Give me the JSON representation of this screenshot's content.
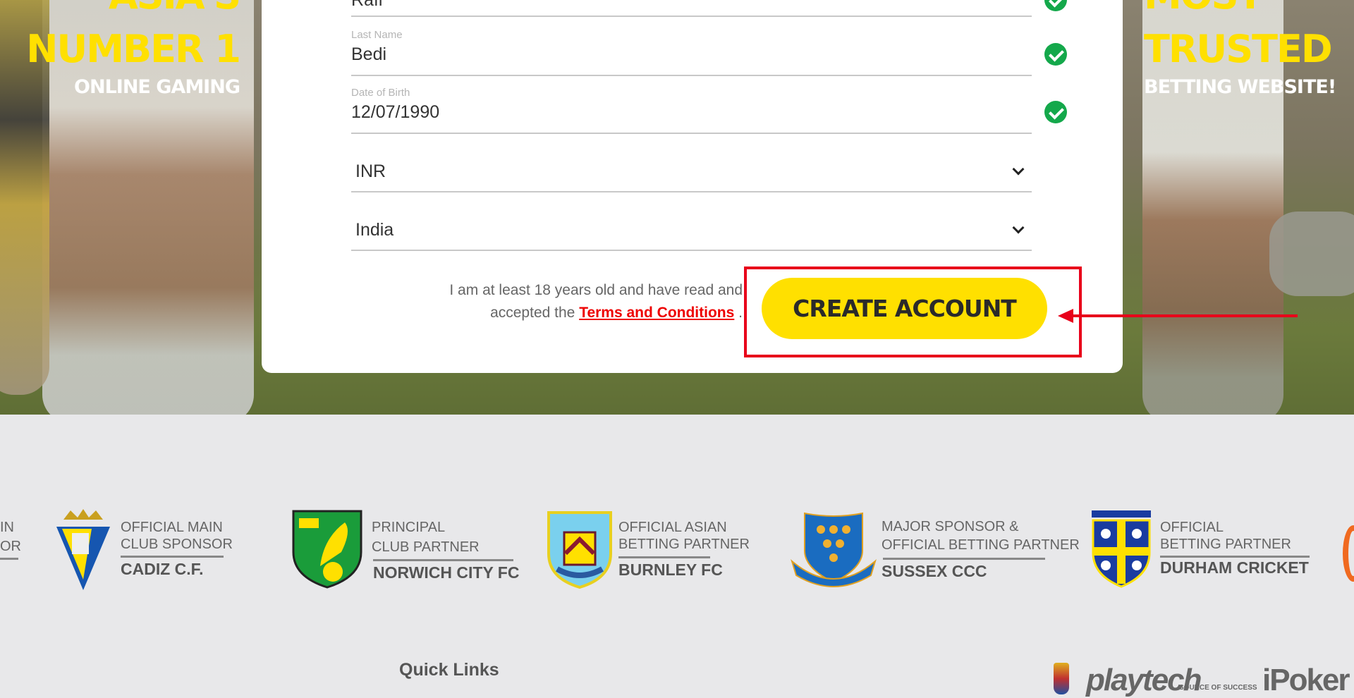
{
  "hero_left": {
    "line1": "ASIA'S",
    "line2": "NUMBER 1",
    "line3": "ONLINE GAMING"
  },
  "hero_right": {
    "line1": "MOST",
    "line2": "TRUSTED",
    "line3": "BETTING WEBSITE!"
  },
  "form": {
    "first_name": {
      "value": "Rafi"
    },
    "last_name": {
      "label": "Last Name",
      "value": "Bedi"
    },
    "dob": {
      "label": "Date of Birth",
      "value": "12/07/1990"
    },
    "currency": {
      "value": "INR"
    },
    "country": {
      "value": "India"
    },
    "terms_text_1": "I am at least 18 years old and have read and",
    "terms_text_2": "accepted the",
    "terms_link": "Terms and Conditions",
    "terms_end": ".",
    "create_button": "CREATE ACCOUNT"
  },
  "colors": {
    "accent": "#ffe000",
    "valid": "#14a84b",
    "highlight": "#e8001a",
    "link": "#e00000"
  },
  "sponsors": [
    {
      "l1": "IN",
      "l2": "OR",
      "name": ""
    },
    {
      "l1": "OFFICIAL MAIN",
      "l2": "CLUB SPONSOR",
      "name": "CADIZ C.F."
    },
    {
      "l1": "PRINCIPAL",
      "l2": "CLUB PARTNER",
      "name": "NORWICH CITY FC"
    },
    {
      "l1": "OFFICIAL ASIAN",
      "l2": "BETTING PARTNER",
      "name": "BURNLEY FC"
    },
    {
      "l1": "MAJOR SPONSOR &",
      "l2": "OFFICIAL BETTING PARTNER",
      "name": "SUSSEX CCC"
    },
    {
      "l1": "OFFICIAL",
      "l2": "BETTING PARTNER",
      "name": "DURHAM CRICKET"
    }
  ],
  "footer": {
    "quick_links": "Quick Links",
    "provider1": "playtech",
    "provider1_tag": "SOURCE OF SUCCESS",
    "provider2": "iPoker"
  }
}
